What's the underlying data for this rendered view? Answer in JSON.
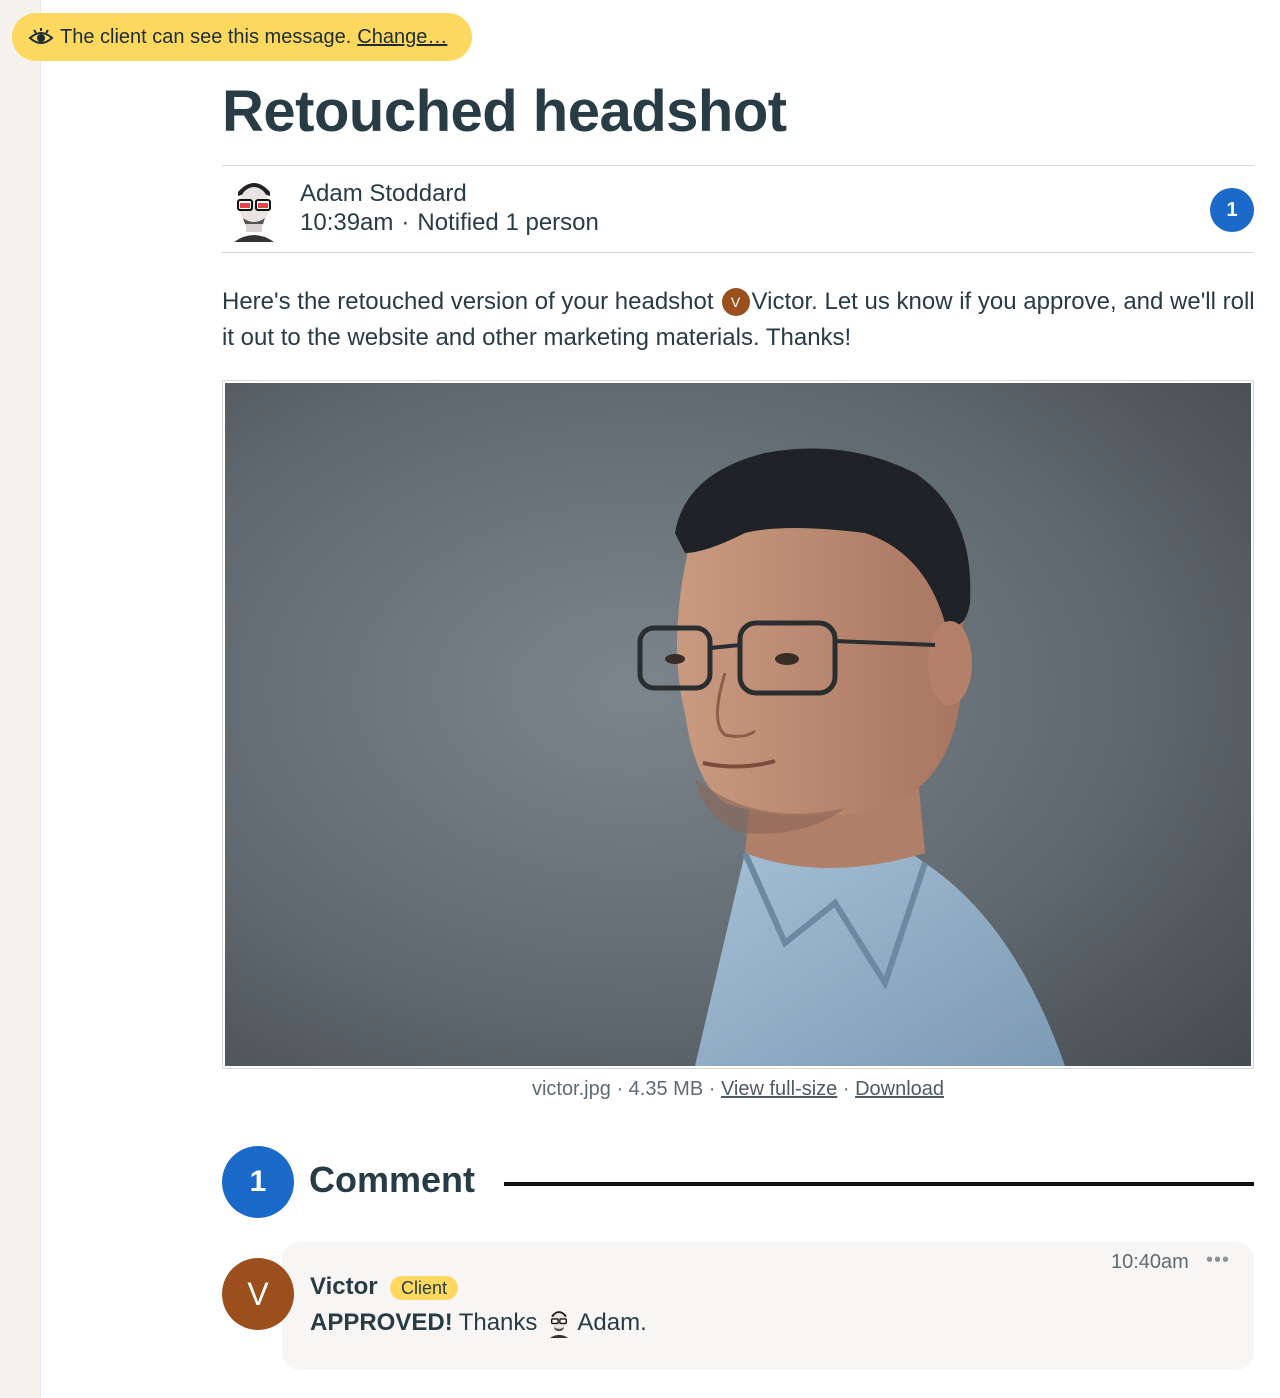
{
  "banner": {
    "icon": "eye-icon",
    "text": "The client can see this message.",
    "link": "Change…"
  },
  "message": {
    "title": "Retouched headshot",
    "author": {
      "name": "Adam Stoddard",
      "time": "10:39am",
      "separator": "·",
      "notified": "Notified 1 person"
    },
    "boost_count": "1",
    "body": {
      "before_mention": "Here's the retouched version of your headshot",
      "mention_initial": "V",
      "mention_name": "Victor.",
      "after_mention": "Let us know if you approve, and we'll roll it out to the website and other marketing materials. Thanks!"
    },
    "attachment": {
      "filename": "victor.jpg",
      "size": "4.35 MB",
      "view_link": "View full-size",
      "download_link": "Download",
      "separator": "·"
    }
  },
  "comments": {
    "count": "1",
    "heading": "Comment",
    "items": [
      {
        "initial": "V",
        "name": "Victor",
        "badge": "Client",
        "time": "10:40am",
        "menu": "•••",
        "bold_text": "APPROVED!",
        "text": "Thanks",
        "mention_name": "Adam."
      }
    ]
  },
  "colors": {
    "banner_yellow": "#fcd95e",
    "accent_blue": "#1b6ac9",
    "client_brown": "#9a4f1c",
    "text_dark": "#283c46",
    "sidebar": "#f5f1ed",
    "comment_bg": "#f8f6f4"
  }
}
